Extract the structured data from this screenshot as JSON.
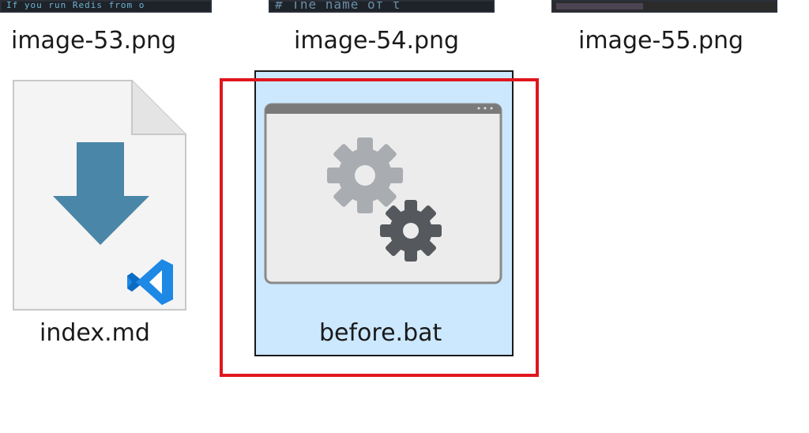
{
  "files": [
    {
      "name": "image-53.png",
      "thumb_text": "If you run Redis from o"
    },
    {
      "name": "image-54.png",
      "thumb_text": "# The name of t"
    },
    {
      "name": "image-55.png"
    },
    {
      "name": "index.md",
      "icon": "markdown-vscode-icon"
    },
    {
      "name": "before.bat",
      "icon": "batch-gears-icon",
      "selected": true
    }
  ],
  "colors": {
    "selection": "#cce8ff",
    "highlight": "#e0161e",
    "arrow": "#4a86a8",
    "vscode": "#1e88e5"
  }
}
